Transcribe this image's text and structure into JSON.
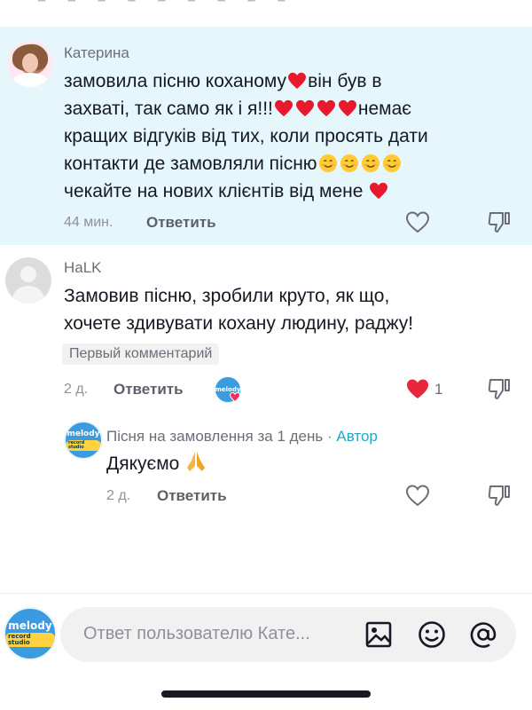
{
  "comments": [
    {
      "author": "Катерина",
      "text_lines": [
        "замовила пісню коханому",
        "він був в",
        "захваті, так само як і я!!!",
        "немає",
        "кращих відгуків від тих, коли просять дати",
        "контакти де замовляли пісню",
        "чекайте на нових клієнтів від мене"
      ],
      "time": "44 мин.",
      "reply_label": "Ответить"
    },
    {
      "author": "HaLK",
      "text_lines": [
        "Замовив пісню, зробили круто, як що,",
        "хочете здивувати кохану людину, раджу!"
      ],
      "pill": "Первый комментарий",
      "time": "2 д.",
      "reply_label": "Ответить",
      "like_count": "1"
    },
    {
      "author": "Пісня на замовлення за 1 день",
      "author_tag": "· Автор",
      "text": "Дякуємо",
      "time": "2 д.",
      "reply_label": "Ответить"
    }
  ],
  "avatar_logo": {
    "line1": "melody",
    "line2": "record studio"
  },
  "composer": {
    "placeholder": "Ответ пользователю Кате..."
  },
  "colors": {
    "highlight_bg": "#e6f7fb",
    "like_red": "#fe2c55",
    "author_tag": "#25a5c7",
    "brand_blue": "#3b9be0"
  },
  "icons": [
    "heart-outline-icon",
    "dislike-icon",
    "heart-filled-icon",
    "image-icon",
    "emoji-icon",
    "mention-icon",
    "prayer-hands-icon",
    "smile-emoji-icon"
  ]
}
